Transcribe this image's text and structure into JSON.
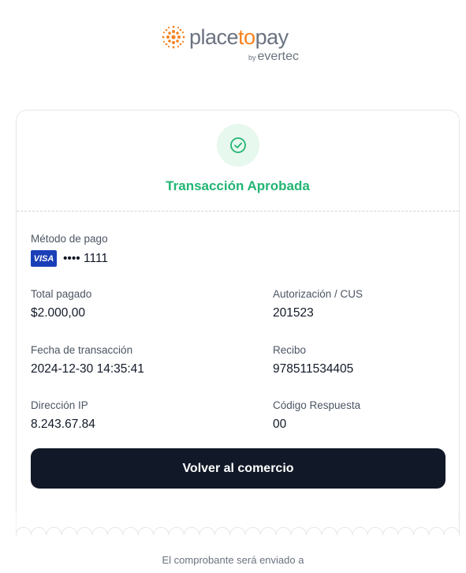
{
  "brand": {
    "name_part1": "place",
    "name_part2": "to",
    "name_part3": "pay",
    "by": "by",
    "parent": "evertec",
    "accent_color": "#f58220"
  },
  "status": {
    "icon": "check-circle-icon",
    "text": "Transacción Aprobada",
    "color": "#22b573"
  },
  "payment_method": {
    "label": "Método de pago",
    "card_brand": "VISA",
    "card_mask": "•••• 1111"
  },
  "details": {
    "total_label": "Total pagado",
    "total_value": "$2.000,00",
    "auth_label": "Autorización / CUS",
    "auth_value": "201523",
    "date_label": "Fecha de transacción",
    "date_value": "2024-12-30 14:35:41",
    "receipt_label": "Recibo",
    "receipt_value": "978511534405",
    "ip_label": "Dirección IP",
    "ip_value": "8.243.67.84",
    "code_label": "Código Respuesta",
    "code_value": "00"
  },
  "actions": {
    "back_button": "Volver al comercio"
  },
  "footer": {
    "note": "El comprobante será enviado a"
  }
}
